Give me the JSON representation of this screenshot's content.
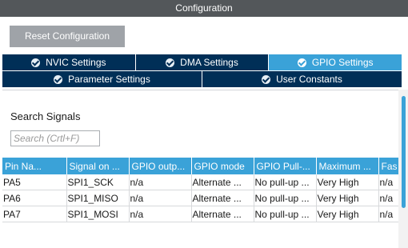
{
  "window": {
    "title": "Configuration"
  },
  "toolbar": {
    "reset_label": "Reset Configuration"
  },
  "tabs_row1": [
    {
      "label": "NVIC Settings",
      "active": false
    },
    {
      "label": "DMA Settings",
      "active": false
    },
    {
      "label": "GPIO Settings",
      "active": true
    }
  ],
  "tabs_row2": [
    {
      "label": "Parameter Settings",
      "active": false
    },
    {
      "label": "User Constants",
      "active": false
    }
  ],
  "search": {
    "label": "Search Signals",
    "placeholder": "Search (Crtl+F)",
    "value": ""
  },
  "table": {
    "columns": [
      "Pin Na...",
      "Signal on ...",
      "GPIO outp...",
      "GPIO mode",
      "GPIO Pull-...",
      "Maximum ...",
      "Fas"
    ],
    "rows": [
      [
        "PA5",
        "SPI1_SCK",
        "n/a",
        "Alternate ...",
        "No pull-up ...",
        "Very High",
        "n/a"
      ],
      [
        "PA6",
        "SPI1_MISO",
        "n/a",
        "Alternate ...",
        "No pull-up ...",
        "Very High",
        "n/a"
      ],
      [
        "PA7",
        "SPI1_MOSI",
        "n/a",
        "Alternate ...",
        "No pull-up ...",
        "Very High",
        "n/a"
      ]
    ]
  },
  "colors": {
    "title_bar": "#53575a",
    "tab_bar": "#002f57",
    "accent": "#3aa2d8",
    "button": "#9fa3a8"
  },
  "icons": {
    "tab_status": "check-circle-icon"
  }
}
